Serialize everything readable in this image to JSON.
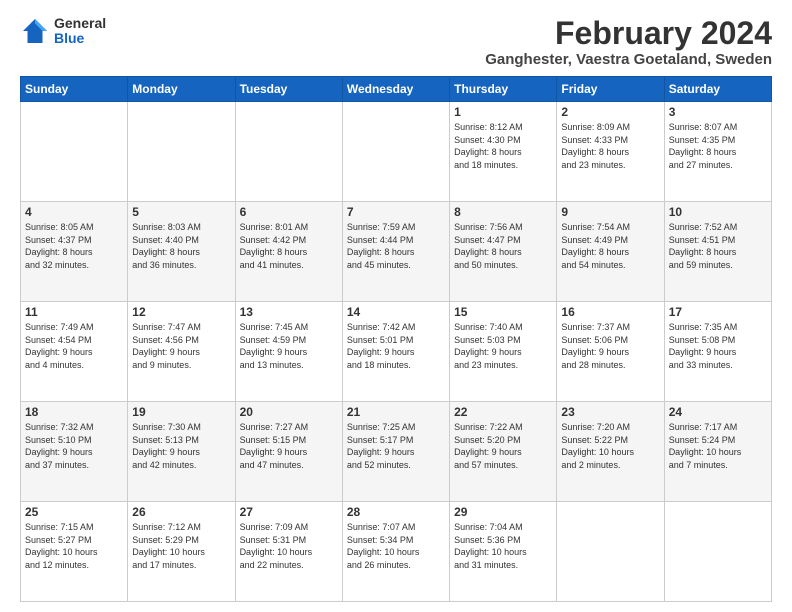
{
  "logo": {
    "general": "General",
    "blue": "Blue"
  },
  "header": {
    "month": "February 2024",
    "location": "Ganghester, Vaestra Goetaland, Sweden"
  },
  "days_of_week": [
    "Sunday",
    "Monday",
    "Tuesday",
    "Wednesday",
    "Thursday",
    "Friday",
    "Saturday"
  ],
  "weeks": [
    [
      {
        "day": "",
        "info": ""
      },
      {
        "day": "",
        "info": ""
      },
      {
        "day": "",
        "info": ""
      },
      {
        "day": "",
        "info": ""
      },
      {
        "day": "1",
        "info": "Sunrise: 8:12 AM\nSunset: 4:30 PM\nDaylight: 8 hours\nand 18 minutes."
      },
      {
        "day": "2",
        "info": "Sunrise: 8:09 AM\nSunset: 4:33 PM\nDaylight: 8 hours\nand 23 minutes."
      },
      {
        "day": "3",
        "info": "Sunrise: 8:07 AM\nSunset: 4:35 PM\nDaylight: 8 hours\nand 27 minutes."
      }
    ],
    [
      {
        "day": "4",
        "info": "Sunrise: 8:05 AM\nSunset: 4:37 PM\nDaylight: 8 hours\nand 32 minutes."
      },
      {
        "day": "5",
        "info": "Sunrise: 8:03 AM\nSunset: 4:40 PM\nDaylight: 8 hours\nand 36 minutes."
      },
      {
        "day": "6",
        "info": "Sunrise: 8:01 AM\nSunset: 4:42 PM\nDaylight: 8 hours\nand 41 minutes."
      },
      {
        "day": "7",
        "info": "Sunrise: 7:59 AM\nSunset: 4:44 PM\nDaylight: 8 hours\nand 45 minutes."
      },
      {
        "day": "8",
        "info": "Sunrise: 7:56 AM\nSunset: 4:47 PM\nDaylight: 8 hours\nand 50 minutes."
      },
      {
        "day": "9",
        "info": "Sunrise: 7:54 AM\nSunset: 4:49 PM\nDaylight: 8 hours\nand 54 minutes."
      },
      {
        "day": "10",
        "info": "Sunrise: 7:52 AM\nSunset: 4:51 PM\nDaylight: 8 hours\nand 59 minutes."
      }
    ],
    [
      {
        "day": "11",
        "info": "Sunrise: 7:49 AM\nSunset: 4:54 PM\nDaylight: 9 hours\nand 4 minutes."
      },
      {
        "day": "12",
        "info": "Sunrise: 7:47 AM\nSunset: 4:56 PM\nDaylight: 9 hours\nand 9 minutes."
      },
      {
        "day": "13",
        "info": "Sunrise: 7:45 AM\nSunset: 4:59 PM\nDaylight: 9 hours\nand 13 minutes."
      },
      {
        "day": "14",
        "info": "Sunrise: 7:42 AM\nSunset: 5:01 PM\nDaylight: 9 hours\nand 18 minutes."
      },
      {
        "day": "15",
        "info": "Sunrise: 7:40 AM\nSunset: 5:03 PM\nDaylight: 9 hours\nand 23 minutes."
      },
      {
        "day": "16",
        "info": "Sunrise: 7:37 AM\nSunset: 5:06 PM\nDaylight: 9 hours\nand 28 minutes."
      },
      {
        "day": "17",
        "info": "Sunrise: 7:35 AM\nSunset: 5:08 PM\nDaylight: 9 hours\nand 33 minutes."
      }
    ],
    [
      {
        "day": "18",
        "info": "Sunrise: 7:32 AM\nSunset: 5:10 PM\nDaylight: 9 hours\nand 37 minutes."
      },
      {
        "day": "19",
        "info": "Sunrise: 7:30 AM\nSunset: 5:13 PM\nDaylight: 9 hours\nand 42 minutes."
      },
      {
        "day": "20",
        "info": "Sunrise: 7:27 AM\nSunset: 5:15 PM\nDaylight: 9 hours\nand 47 minutes."
      },
      {
        "day": "21",
        "info": "Sunrise: 7:25 AM\nSunset: 5:17 PM\nDaylight: 9 hours\nand 52 minutes."
      },
      {
        "day": "22",
        "info": "Sunrise: 7:22 AM\nSunset: 5:20 PM\nDaylight: 9 hours\nand 57 minutes."
      },
      {
        "day": "23",
        "info": "Sunrise: 7:20 AM\nSunset: 5:22 PM\nDaylight: 10 hours\nand 2 minutes."
      },
      {
        "day": "24",
        "info": "Sunrise: 7:17 AM\nSunset: 5:24 PM\nDaylight: 10 hours\nand 7 minutes."
      }
    ],
    [
      {
        "day": "25",
        "info": "Sunrise: 7:15 AM\nSunset: 5:27 PM\nDaylight: 10 hours\nand 12 minutes."
      },
      {
        "day": "26",
        "info": "Sunrise: 7:12 AM\nSunset: 5:29 PM\nDaylight: 10 hours\nand 17 minutes."
      },
      {
        "day": "27",
        "info": "Sunrise: 7:09 AM\nSunset: 5:31 PM\nDaylight: 10 hours\nand 22 minutes."
      },
      {
        "day": "28",
        "info": "Sunrise: 7:07 AM\nSunset: 5:34 PM\nDaylight: 10 hours\nand 26 minutes."
      },
      {
        "day": "29",
        "info": "Sunrise: 7:04 AM\nSunset: 5:36 PM\nDaylight: 10 hours\nand 31 minutes."
      },
      {
        "day": "",
        "info": ""
      },
      {
        "day": "",
        "info": ""
      }
    ]
  ]
}
